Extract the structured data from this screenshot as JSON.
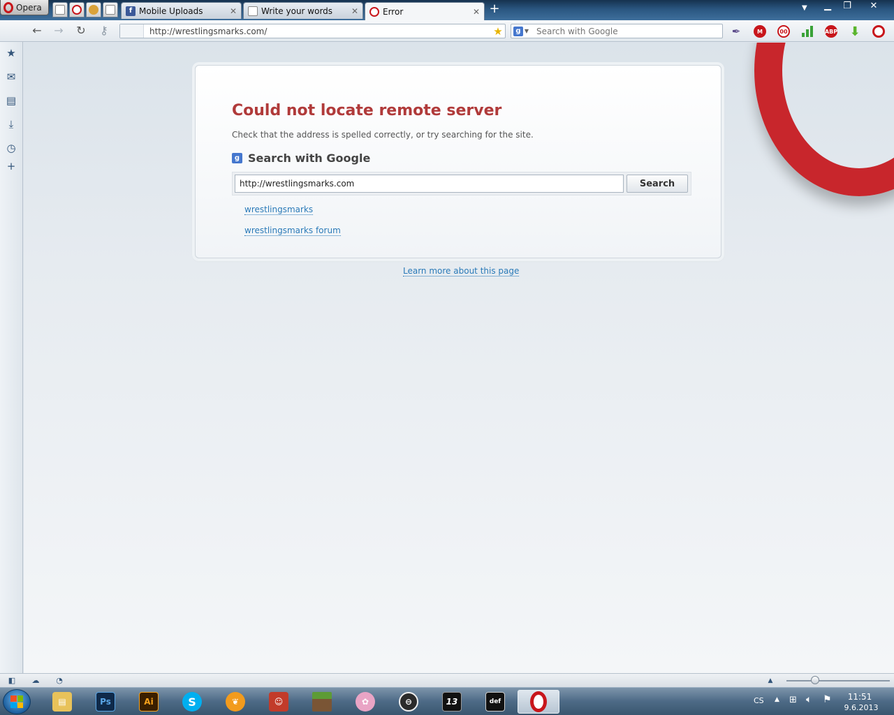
{
  "browser": {
    "menu_label": "Opera",
    "tabs": [
      {
        "title": "Mobile Uploads",
        "active": false
      },
      {
        "title": "Write your words",
        "active": false
      },
      {
        "title": "Error",
        "active": true
      }
    ],
    "address": "http://wrestlingsmarks.com/",
    "search_placeholder": "Search with Google"
  },
  "page": {
    "error_title": "Could not locate remote server",
    "error_description": "Check that the address is spelled correctly, or try searching for the site.",
    "search_heading": "Search with Google",
    "search_input_value": "http://wrestlingsmarks.com",
    "search_button_label": "Search",
    "suggestions": [
      "wrestlingsmarks",
      "wrestlingsmarks forum"
    ],
    "learn_more": "Learn more about this page"
  },
  "taskbar": {
    "language": "CS",
    "time": "11:51",
    "date": "9.6.2013"
  },
  "colors": {
    "error_title": "#b03a3a",
    "link": "#2a7ab8",
    "opera_red": "#c8161b"
  }
}
